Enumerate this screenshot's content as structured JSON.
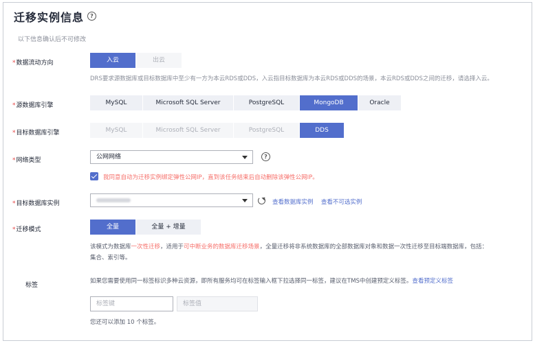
{
  "page": {
    "title": "迁移实例信息",
    "subtitle": "以下信息确认后不可修改"
  },
  "flow_direction": {
    "label": "数据流动方向",
    "options": [
      "入云",
      "出云"
    ],
    "selected": "入云",
    "hint": "DRS要求源数据库或目标数据库中至少有一方为本云RDS或DDS，入云指目标数据库为本云RDS或DDS的场景，本云RDS或DDS之间的迁移，请选择入云。"
  },
  "source_engine": {
    "label": "源数据库引擎",
    "options": [
      "MySQL",
      "Microsoft SQL Server",
      "PostgreSQL",
      "MongoDB",
      "Oracle"
    ],
    "selected": "MongoDB"
  },
  "target_engine": {
    "label": "目标数据库引擎",
    "options": [
      "MySQL",
      "Microsoft SQL Server",
      "PostgreSQL",
      "DDS"
    ],
    "selected": "DDS"
  },
  "network": {
    "label": "网络类型",
    "value": "公网网络",
    "checkbox_text": "我同意自动为迁移实例绑定弹性公网IP，直到该任务结束后自动删除该弹性公网IP。",
    "checked": true
  },
  "target_instance": {
    "label": "目标数据库实例",
    "link_view": "查看数据库实例",
    "link_unavailable": "查看不可选实例"
  },
  "migration_mode": {
    "label": "迁移模式",
    "options": [
      "全量",
      "全量 + 增量"
    ],
    "selected": "全量",
    "hint_1": "该模式为数据库",
    "hint_2": "一次性迁移",
    "hint_3": "，适用于",
    "hint_4": "可中断业务的数据库迁移场景",
    "hint_5": "，全量迁移将非系统数据库的全部数据库对象和数据一次性迁移至目标端数据库，包括：",
    "hint_6": "集合、索引等。"
  },
  "tags": {
    "label": "标签",
    "hint": "如果您需要使用同一标签标识多种云资源，即所有服务均可在标签输入框下拉选择同一标签，建议在TMS中创建预定义标签。",
    "hint_link": "查看预定义标签",
    "key_placeholder": "标签键",
    "value_placeholder": "标签值",
    "footer": "您还可以添加 10 个标签。"
  },
  "icons": {
    "help": "?"
  }
}
